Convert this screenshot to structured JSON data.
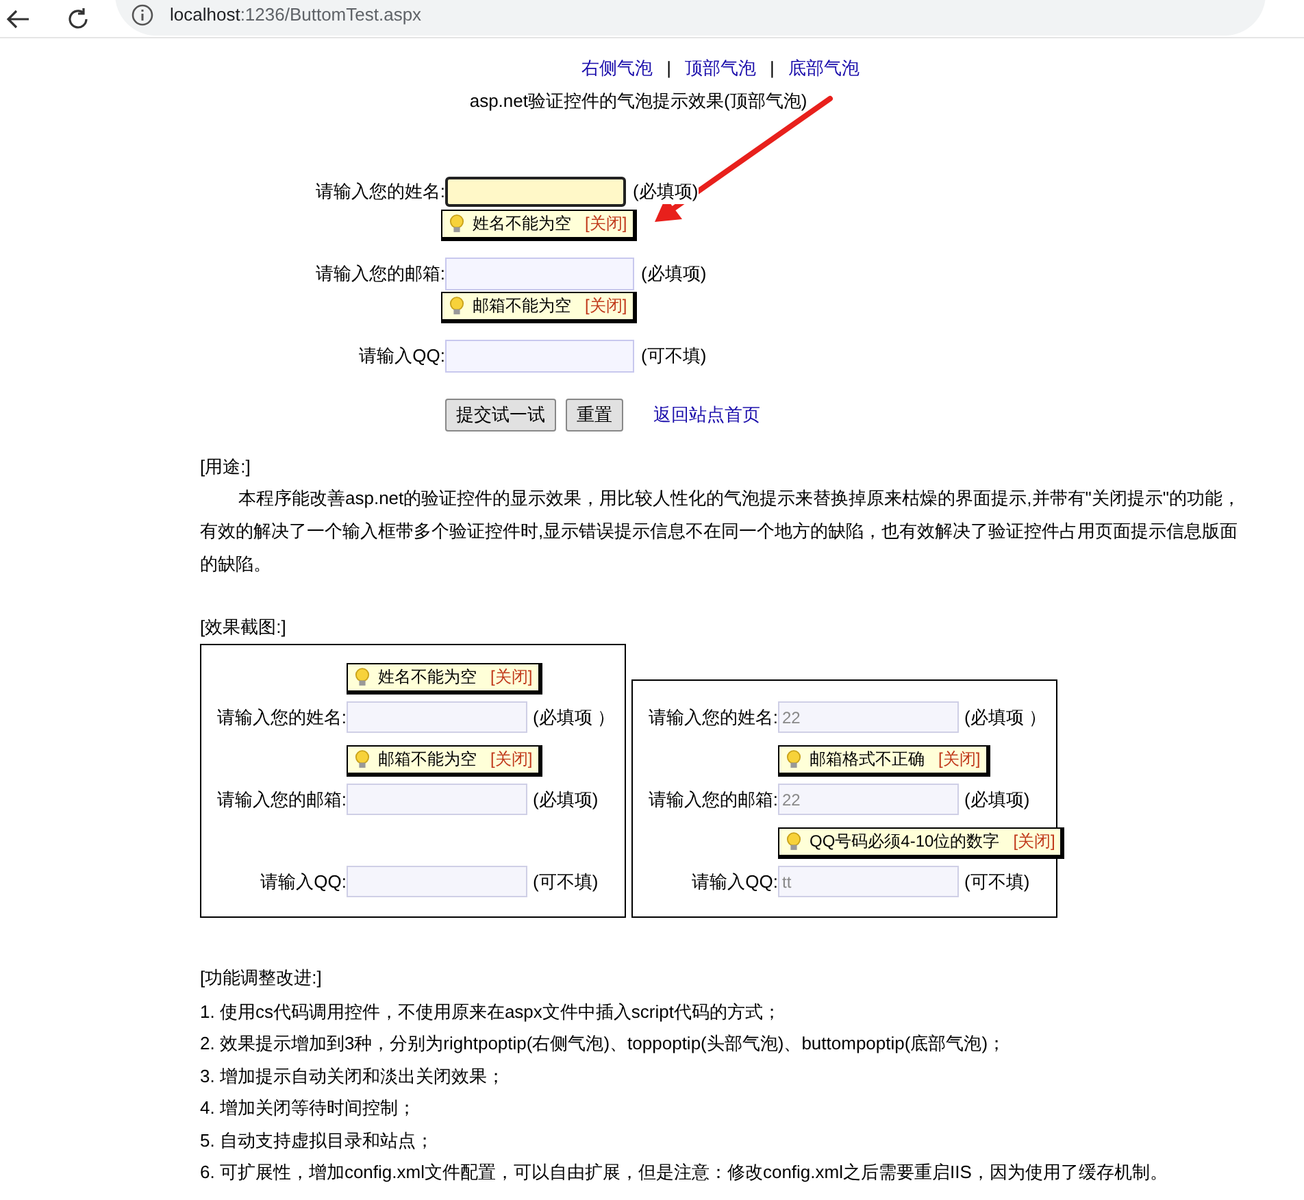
{
  "browser": {
    "url_host": "localhost",
    "url_rest": ":1236/ButtomTest.aspx"
  },
  "nav_links": [
    "右侧气泡",
    "顶部气泡",
    "底部气泡"
  ],
  "nav_separator": "|",
  "page_title": "asp.net验证控件的气泡提示效果(顶部气泡)",
  "form": {
    "rows": [
      {
        "label": "请输入您的姓名:",
        "focused": true,
        "note": "(必填项)",
        "tip": {
          "message": "姓名不能为空",
          "close": "[关闭]"
        }
      },
      {
        "label": "请输入您的邮箱:",
        "focused": false,
        "note": "(必填项)",
        "tip": {
          "message": "邮箱不能为空",
          "close": "[关闭]"
        }
      },
      {
        "label": "请输入QQ:",
        "focused": false,
        "note": "(可不填)"
      }
    ],
    "buttons": [
      "提交试一试",
      "重置"
    ],
    "home_link": "返回站点首页"
  },
  "usage": {
    "heading": "[用途:]",
    "paragraph": "本程序能改善asp.net的验证控件的显示效果，用比较人性化的气泡提示来替换掉原来枯燥的界面提示,并带有\"关闭提示\"的功能，有效的解决了一个输入框带多个验证控件时,显示错误提示信息不在同一个地方的缺陷，也有效解决了验证控件占用页面提示信息版面的缺陷。"
  },
  "screenshots": {
    "heading": "[效果截图:]",
    "panels": [
      {
        "rows": [
          {
            "label": "请输入您的姓名:",
            "value": "",
            "note": "(必填项 ）",
            "tip": {
              "message": "姓名不能为空",
              "close": "[关闭]"
            }
          },
          {
            "label": "请输入您的邮箱:",
            "value": "",
            "note": "(必填项)",
            "tip": {
              "message": "邮箱不能为空",
              "close": "[关闭]"
            }
          },
          {
            "label": "请输入QQ:",
            "value": "",
            "note": "(可不填)"
          }
        ]
      },
      {
        "rows": [
          {
            "label": "请输入您的姓名:",
            "value": "22",
            "note": "(必填项 ）"
          },
          {
            "label": "请输入您的邮箱:",
            "value": "22",
            "note": "(必填项)",
            "tip": {
              "message": "邮箱格式不正确",
              "close": "[关闭]"
            }
          },
          {
            "label": "请输入QQ:",
            "value": "tt",
            "note": "(可不填)",
            "tip": {
              "message": "QQ号码必须4-10位的数字",
              "close": "[关闭]"
            }
          }
        ]
      }
    ]
  },
  "improvements": {
    "heading": "[功能调整改进:]",
    "items": [
      "1. 使用cs代码调用控件，不使用原来在aspx文件中插入script代码的方式；",
      "2. 效果提示增加到3种，分别为rightpoptip(右侧气泡)、toppoptip(头部气泡)、buttompoptip(底部气泡)；",
      "3. 增加提示自动关闭和淡出关闭效果；",
      "4. 增加关闭等待时间控制；",
      "5. 自动支持虚拟目录和站点；",
      "6. 可扩展性，增加config.xml文件配置，可以自由扩展，但是注意：修改config.xml之后需要重启IIS，因为使用了缓存机制。"
    ]
  }
}
